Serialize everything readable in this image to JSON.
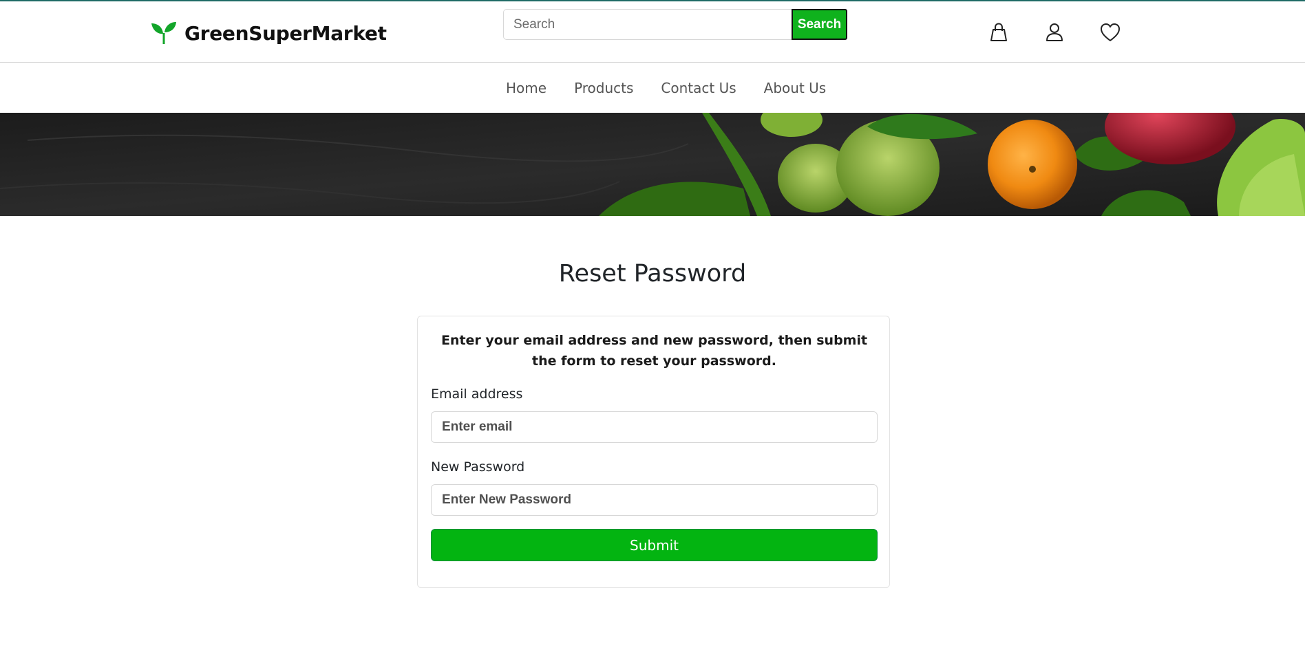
{
  "header": {
    "brand_name": "GreenSuperMarket",
    "search_placeholder": "Search",
    "search_button": "Search"
  },
  "icons": [
    "shopping-bag-icon",
    "user-icon",
    "heart-icon"
  ],
  "nav": {
    "items": [
      {
        "label": "Home"
      },
      {
        "label": "Products"
      },
      {
        "label": "Contact Us"
      },
      {
        "label": "About Us"
      }
    ]
  },
  "main": {
    "title": "Reset Password",
    "description": "Enter your email address and new password, then submit the form to reset your password.",
    "email_label": "Email address",
    "email_placeholder": "Enter email",
    "password_label": "New Password",
    "password_placeholder": "Enter New Password",
    "submit_label": "Submit"
  },
  "colors": {
    "brand_green": "#0fb21d",
    "submit_green": "#03b411",
    "top_line": "#1f6b66"
  }
}
